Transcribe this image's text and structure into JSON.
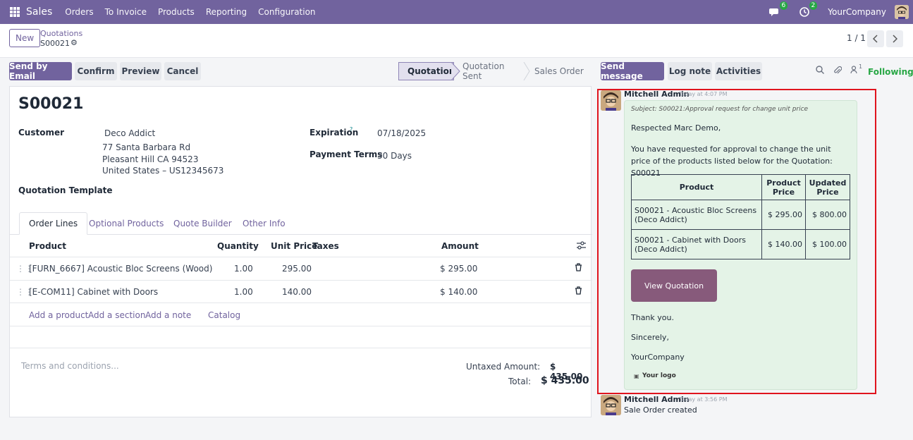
{
  "navbar": {
    "app_name": "Sales",
    "menu": [
      "Orders",
      "To Invoice",
      "Products",
      "Reporting",
      "Configuration"
    ],
    "messages_count": "6",
    "activities_count": "2",
    "company": "YourCompany"
  },
  "control": {
    "new_label": "New",
    "breadcrumb_parent": "Quotations",
    "breadcrumb_current": "S00021",
    "pager": "1 / 1"
  },
  "actions": {
    "send_email": "Send by Email",
    "confirm": "Confirm",
    "preview": "Preview",
    "cancel": "Cancel"
  },
  "status": {
    "stages": [
      "Quotation",
      "Quotation Sent",
      "Sales Order"
    ],
    "active": "Quotation"
  },
  "form": {
    "title": "S00021",
    "customer_label": "Customer",
    "customer_name": "Deco Addict",
    "address_line1": "77 Santa Barbara Rd",
    "address_line2": "Pleasant Hill CA 94523",
    "address_line3": "United States – US12345673",
    "template_label": "Quotation Template",
    "expiration_label": "Expiration",
    "expiration_help": "?",
    "expiration_value": "07/18/2025",
    "payment_terms_label": "Payment Terms",
    "payment_terms_value": "30 Days"
  },
  "tabs": [
    "Order Lines",
    "Optional Products",
    "Quote Builder",
    "Other Info"
  ],
  "order_lines": {
    "headers": {
      "product": "Product",
      "quantity": "Quantity",
      "unit_price": "Unit Price",
      "taxes": "Taxes",
      "amount": "Amount"
    },
    "rows": [
      {
        "product": "[FURN_6667] Acoustic Bloc Screens (Wood)",
        "quantity": "1.00",
        "unit_price": "295.00",
        "amount": "$ 295.00"
      },
      {
        "product": "[E-COM11] Cabinet with Doors",
        "quantity": "1.00",
        "unit_price": "140.00",
        "amount": "$ 140.00"
      }
    ],
    "add_links": [
      "Add a product",
      "Add a section",
      "Add a note",
      "Catalog"
    ]
  },
  "footer": {
    "terms_placeholder": "Terms and conditions...",
    "untaxed_label": "Untaxed Amount:",
    "untaxed_value": "$ 435.00",
    "total_label": "Total:",
    "total_value": "$ 435.00"
  },
  "chatter": {
    "send_message": "Send message",
    "log_note": "Log note",
    "activities": "Activities",
    "followers_count": "1",
    "following": "Following",
    "messages": [
      {
        "author": "Mitchell Admin",
        "time": "Today at 4:07 PM",
        "subject": "Subject: S00021:Approval request for change unit price",
        "greeting": "Respected Marc Demo,",
        "body": "You have requested for approval to change the unit price of the products listed below for the Quotation: S00021",
        "table_headers": {
          "product": "Product",
          "product_price": "Product Price",
          "updated_price": "Updated Price"
        },
        "table_rows": [
          {
            "product": "S00021 - Acoustic Bloc Screens (Deco Addict)",
            "product_price": "$ 295.00",
            "updated_price": "$ 800.00"
          },
          {
            "product": "S00021 - Cabinet with Doors (Deco Addict)",
            "product_price": "$ 140.00",
            "updated_price": "$ 100.00"
          }
        ],
        "button": "View Quotation",
        "thanks": "Thank you.",
        "closing": "Sincerely,",
        "signature": "YourCompany",
        "logo": "Your logo"
      },
      {
        "author": "Mitchell Admin",
        "time": "Today at 3:56 PM",
        "body": "Sale Order created"
      }
    ]
  }
}
